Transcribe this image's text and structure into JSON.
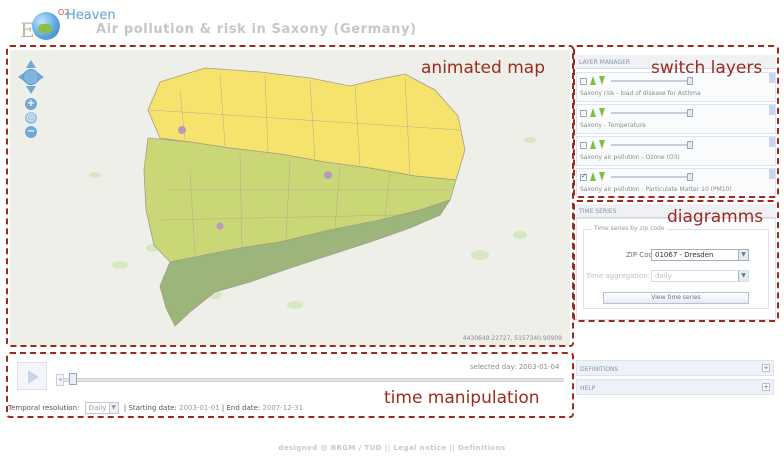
{
  "header": {
    "logo_letter": "E",
    "logo_superscript": "O2",
    "logo_word": "Heaven",
    "title": "Air pollution & risk in Saxony (Germany)"
  },
  "annotations": {
    "map": "animated map",
    "layers": "switch layers",
    "diagrams": "diagramms",
    "time": "time manipulation"
  },
  "map": {
    "coordinates": "4430649.22727, 5157340.90909",
    "zoom_in": "+",
    "zoom_out": "−",
    "colors": {
      "background": "#efefe9",
      "region_yellow": "#f6e36e",
      "region_lightgreen": "#c9d777",
      "region_green": "#9cb57a",
      "border": "#a59d86",
      "green_patches": "#d5e8c2",
      "city_markers": "#b99ab8"
    }
  },
  "layer_manager": {
    "title": "LAYER MANAGER",
    "layers": [
      {
        "name": "Saxony risk - load of disease for Asthma",
        "checked": false
      },
      {
        "name": "Saxony - Temperature",
        "checked": false
      },
      {
        "name": "Saxony air pollution - Ozone (O3)",
        "checked": false
      },
      {
        "name": "Saxony air pollution - Particulate Matter 10 (PM10)",
        "checked": true
      }
    ]
  },
  "time_series": {
    "title": "TIME SERIES",
    "legend": "Time series by zip code",
    "zip_label": "ZIP Code:",
    "zip_value": "01067 - Dresden",
    "aggregation_label": "Time aggregation:",
    "aggregation_value": "daily",
    "button": "View time series"
  },
  "collapsed_panels": {
    "definitions": "DEFINITIONS",
    "help": "HELP",
    "expand": "+"
  },
  "time_controls": {
    "selected_day_label": "selected day: 2003-01-04",
    "resolution_label": "Temporal resolution:",
    "resolution_value": "Daily",
    "separator": "|",
    "start_label": "Starting date:",
    "start_value": "2003-01-01",
    "end_label": "End date:",
    "end_value": "2007-12-31"
  },
  "footer": {
    "text": "designed @ BRGM / TUD || Legal notice || Definitions"
  }
}
